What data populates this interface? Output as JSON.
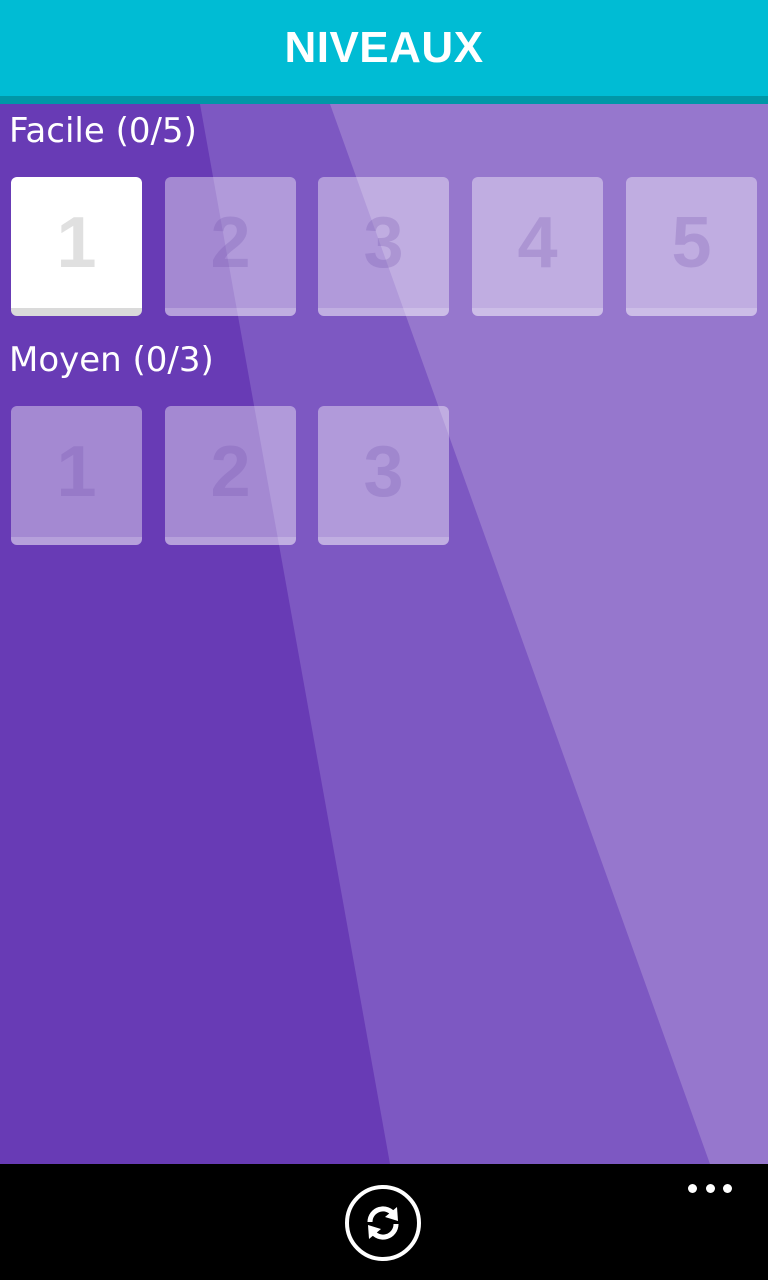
{
  "header": {
    "title": "NIVEAUX"
  },
  "colors": {
    "header_bg": "#00bcd4",
    "header_border": "#0097a7",
    "background": "#683bb5",
    "appbar_bg": "#000000"
  },
  "sections": [
    {
      "title": "Facile (0/5)",
      "levels": [
        {
          "label": "1",
          "state": "unlocked"
        },
        {
          "label": "2",
          "state": "locked"
        },
        {
          "label": "3",
          "state": "locked"
        },
        {
          "label": "4",
          "state": "locked"
        },
        {
          "label": "5",
          "state": "locked"
        }
      ]
    },
    {
      "title": "Moyen (0/3)",
      "levels": [
        {
          "label": "1",
          "state": "locked"
        },
        {
          "label": "2",
          "state": "locked"
        },
        {
          "label": "3",
          "state": "locked"
        }
      ]
    }
  ],
  "appbar": {
    "refresh_icon": "refresh-icon",
    "more_icon": "more-ellipsis-icon"
  }
}
